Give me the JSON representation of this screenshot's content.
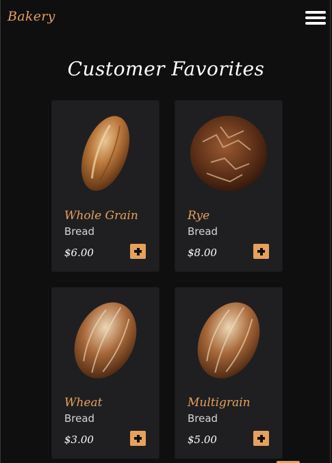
{
  "header": {
    "brand": "Bakery",
    "menu_icon": "hamburger-menu-icon"
  },
  "section": {
    "title": "Customer Favorites"
  },
  "colors": {
    "background": "#0f0f0f",
    "card": "#1f1f21",
    "accent": "#e6a15c",
    "text": "#ffffff"
  },
  "products": [
    {
      "name": "Whole Grain",
      "category": "Bread",
      "price": "$6.00",
      "image": "bread-loaf-oblong"
    },
    {
      "name": "Rye",
      "category": "Bread",
      "price": "$8.00",
      "image": "bread-loaf-round"
    },
    {
      "name": "Wheat",
      "category": "Bread",
      "price": "$3.00",
      "image": "bread-loaf-oval"
    },
    {
      "name": "Multigrain",
      "category": "Bread",
      "price": "$5.00",
      "image": "bread-loaf-oval"
    }
  ],
  "add_icon": "plus-icon"
}
